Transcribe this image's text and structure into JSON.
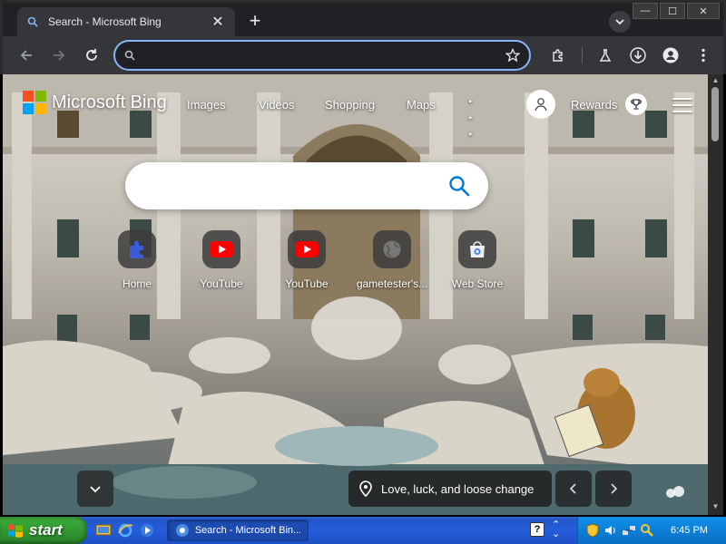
{
  "browser": {
    "tab": {
      "title": "Search - Microsoft Bing",
      "close_glyph": "✕"
    },
    "new_tab_glyph": "+",
    "window_controls": {
      "minimize": "—",
      "maximize": "☐",
      "close": "✕"
    },
    "address_bar": {
      "value": "",
      "placeholder": ""
    }
  },
  "bing": {
    "logo_text": "Microsoft Bing",
    "nav": [
      "Images",
      "Videos",
      "Shopping",
      "Maps"
    ],
    "more": "· · ·",
    "rewards_label": "Rewards",
    "search": {
      "value": "",
      "placeholder": ""
    },
    "shortcuts": [
      {
        "label": "Home",
        "icon": "puzzle-icon",
        "color": "#3b5bdb"
      },
      {
        "label": "YouTube",
        "icon": "youtube-icon",
        "color": "#ff0000"
      },
      {
        "label": "YouTube",
        "icon": "youtube-icon",
        "color": "#ff0000"
      },
      {
        "label": "gametester's...",
        "icon": "globe-icon",
        "color": "#666666"
      },
      {
        "label": "Web Store",
        "icon": "webstore-icon",
        "color": "#4285f4"
      }
    ],
    "caption": "Love, luck, and loose change"
  },
  "taskbar": {
    "start_label": "start",
    "task_title": "Search - Microsoft Bin...",
    "help_glyph": "?",
    "clock": "6:45 PM"
  },
  "colors": {
    "chrome_bg": "#202124",
    "toolbar_bg": "#35363a",
    "omnibox_border": "#8ab4f8",
    "bing_blue": "#0078d4",
    "xp_taskbar": "#245edb",
    "xp_start": "#37a637"
  }
}
